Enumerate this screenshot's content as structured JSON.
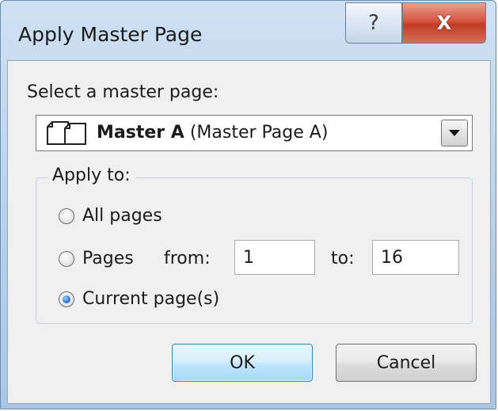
{
  "window": {
    "title": "Apply Master Page"
  },
  "caption_buttons": {
    "help_glyph": "?",
    "close_glyph": "X"
  },
  "master_select": {
    "label": "Select a master page:",
    "name": "Master A",
    "description": "(Master Page A)",
    "icon": "master-pages-icon"
  },
  "apply_to": {
    "legend": "Apply to:",
    "options": [
      {
        "label": "All pages",
        "selected": false
      },
      {
        "label": "Pages",
        "selected": false
      },
      {
        "label": "Current page(s)",
        "selected": true
      }
    ],
    "from_label": "from:",
    "from_value": "1",
    "to_label": "to:",
    "to_value": "16"
  },
  "buttons": {
    "ok": "OK",
    "cancel": "Cancel"
  },
  "colors": {
    "title_bar": "#b9d1ea",
    "close_button": "#c13b24",
    "ok_border": "#3c7fb1",
    "client_bg": "#f0f0f0"
  }
}
